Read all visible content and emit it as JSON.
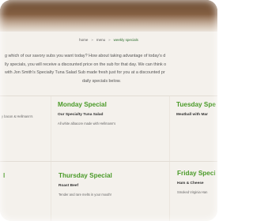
{
  "breadcrumb": {
    "home": "home",
    "menu": "menu",
    "current": "weekly specials",
    "separator": "»"
  },
  "intro": {
    "line1": "g which of our savory subs you want today? How about taking advantage of today's d",
    "line2": "lly specials, you will receive a discounted price on the sub for that day. We can think o",
    "line3": "with Jon Smith's Specialty Tuna Salad Sub made fresh just for you at a discounted pr",
    "line4": "daily specials below."
  },
  "specials_row1": {
    "left_desc": "y bacon & Hellmann's",
    "monday": {
      "day": "Monday Special",
      "sub": "Our Specialty Tuna Salad",
      "desc": "All white albacore made with Hellmann's"
    },
    "tuesday": {
      "day": "Tuesday Spe",
      "sub": "Meatball with Mar"
    }
  },
  "specials_row2": {
    "left_day": "l",
    "thursday": {
      "day": "Thursday Special",
      "sub": "Roast Beef",
      "desc": "Tender and rare melts in your mouth!"
    },
    "friday": {
      "day": "Friday Speci",
      "sub": "Ham & Cheese",
      "desc": "Smoked Virginia Han"
    }
  },
  "colors": {
    "accent_green": "#4a9a28",
    "background": "#f4f1ec",
    "hero": "#8a6446"
  }
}
